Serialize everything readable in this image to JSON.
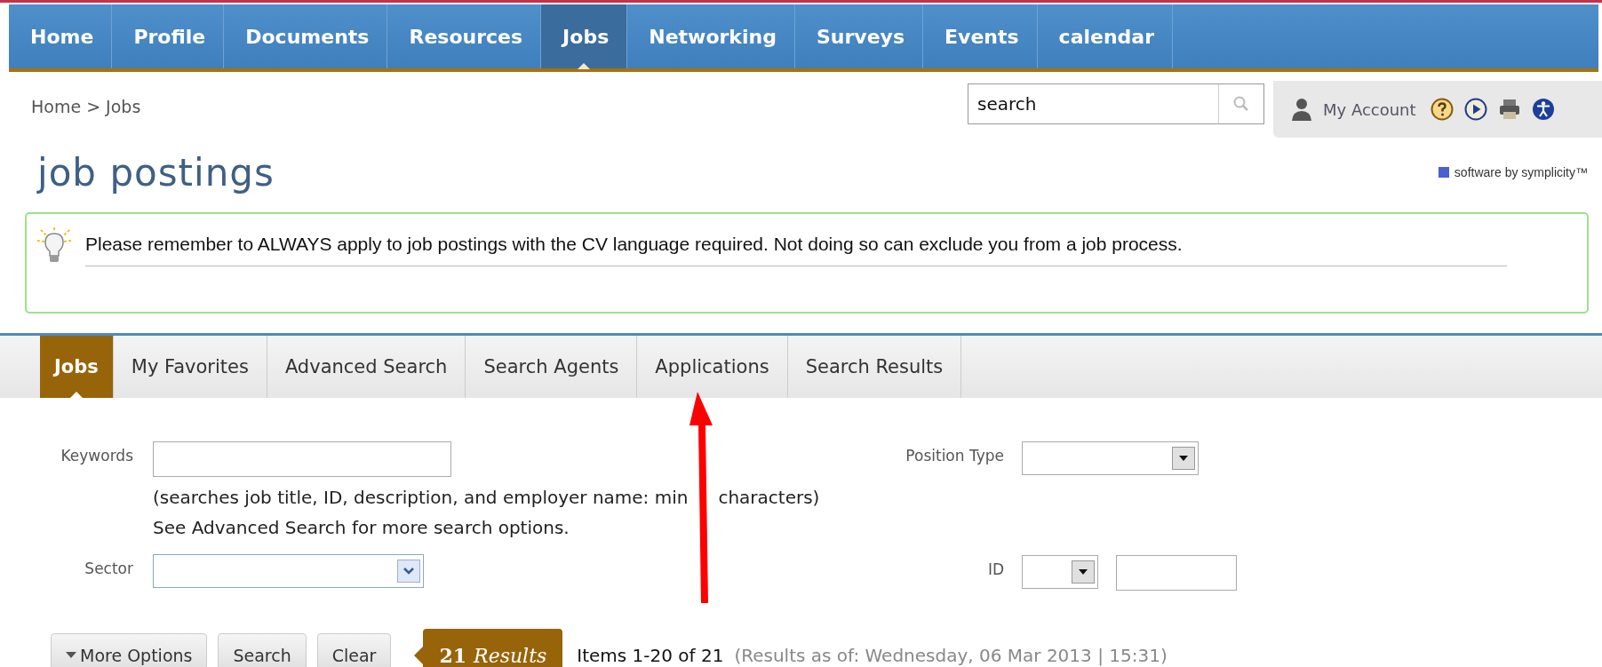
{
  "nav": [
    {
      "label": "Home",
      "selected": false
    },
    {
      "label": "Profile",
      "selected": false
    },
    {
      "label": "Documents",
      "selected": false
    },
    {
      "label": "Resources",
      "selected": false
    },
    {
      "label": "Jobs",
      "selected": true
    },
    {
      "label": "Networking",
      "selected": false
    },
    {
      "label": "Surveys",
      "selected": false
    },
    {
      "label": "Events",
      "selected": false
    },
    {
      "label": "calendar",
      "selected": false
    }
  ],
  "breadcrumb": "Home > Jobs",
  "search": {
    "value": "search"
  },
  "account": "My Account",
  "page_title": "job postings",
  "brand": "software by symplicity™",
  "notice": "Please remember to ALWAYS apply to job postings with the CV language required. Not doing so can exclude you from a job process.",
  "tabs": [
    {
      "label": "Jobs",
      "selected": true
    },
    {
      "label": "My Favorites",
      "selected": false
    },
    {
      "label": "Advanced Search",
      "selected": false
    },
    {
      "label": "Search Agents",
      "selected": false
    },
    {
      "label": "Applications",
      "selected": false
    },
    {
      "label": "Search Results",
      "selected": false
    }
  ],
  "form": {
    "keywords_label": "Keywords",
    "hint_start": "(searches job title, ID, description, and employer name: min",
    "hint_end": "characters)",
    "advanced_note": "See Advanced Search for more search options.",
    "position_type_label": "Position Type",
    "sector_label": "Sector",
    "id_label": "ID"
  },
  "buttons": [
    "More Options",
    "Search",
    "Clear"
  ],
  "results": {
    "count": "21",
    "label": "Results",
    "items": "Items 1-20 of 21",
    "as_of": "(Results as of: Wednesday, 06 Mar 2013 | 15:31)"
  }
}
